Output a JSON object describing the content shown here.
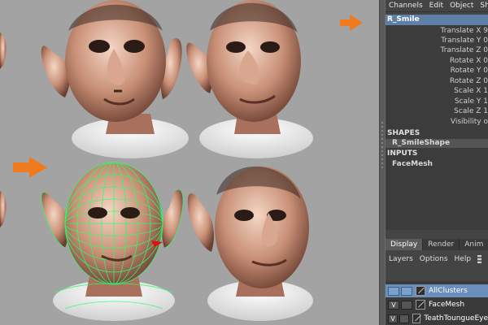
{
  "menubar": [
    "Channels",
    "Edit",
    "Object",
    "Sho"
  ],
  "channel_box": {
    "object_name": "R_Smile",
    "attributes": [
      "Translate X 9",
      "Translate Y 0",
      "Translate Z 0",
      "Rotate X 0",
      "Rotate Y 0",
      "Rotate Z 0",
      "Scale X 1",
      "Scale Y 1",
      "Scale Z 1",
      "Visibility o"
    ],
    "shapes_header": "SHAPES",
    "shape_node": "R_SmileShape",
    "inputs_header": "INPUTS",
    "input_node": "FaceMesh"
  },
  "layer_editor": {
    "tabs": [
      "Display",
      "Render",
      "Anim"
    ],
    "menus": [
      "Layers",
      "Options",
      "Help"
    ],
    "layers": [
      {
        "v": "",
        "name": "AllClusters"
      },
      {
        "v": "V",
        "name": "FaceMesh"
      },
      {
        "v": "V",
        "name": "TeathToungueEye"
      }
    ]
  },
  "colors": {
    "accent": "#5d7fa8",
    "arrow": "#f07a1e",
    "wireframe": "#2aff6a"
  }
}
